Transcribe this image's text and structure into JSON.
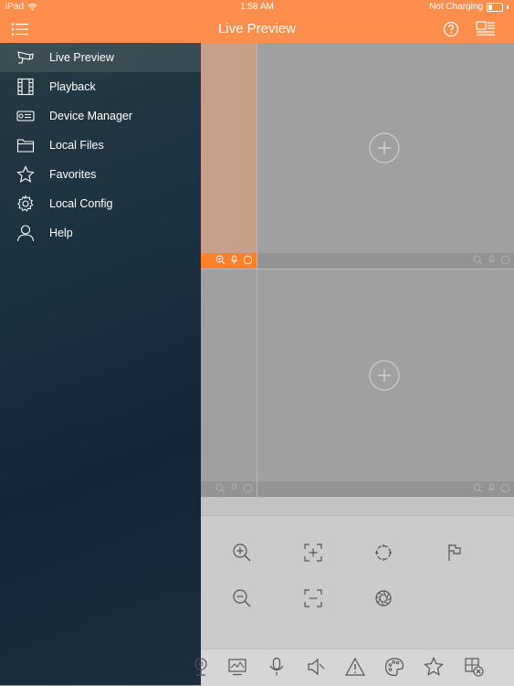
{
  "status_bar": {
    "device": "iPad",
    "time": "1:58 AM",
    "battery": "Not Charging"
  },
  "header": {
    "title": "Live Preview",
    "menu_icon": "list-menu-icon",
    "help_icon": "help-circle-icon",
    "layout_icon": "window-layout-icon"
  },
  "sidebar": {
    "items": [
      {
        "label": "Live Preview",
        "icon": "camera-icon",
        "active": true
      },
      {
        "label": "Playback",
        "icon": "film-icon",
        "active": false
      },
      {
        "label": "Device Manager",
        "icon": "dvr-device-icon",
        "active": false
      },
      {
        "label": "Local Files",
        "icon": "folder-icon",
        "active": false
      },
      {
        "label": "Favorites",
        "icon": "star-icon",
        "active": false
      },
      {
        "label": "Local Config",
        "icon": "gear-icon",
        "active": false
      },
      {
        "label": "Help",
        "icon": "user-icon",
        "active": false
      }
    ]
  },
  "video_panes": {
    "count": 4,
    "selected_index": 0,
    "bar_icons": [
      "zoom-icon",
      "microphone-icon",
      "record-icon"
    ],
    "add_icon": "add-channel-icon"
  },
  "ptz_controls": {
    "buttons": [
      "zoom-in-icon",
      "focus-plus-icon",
      "iris-open-icon",
      "preset-flag-icon",
      "zoom-out-icon",
      "focus-minus-icon",
      "iris-close-icon"
    ]
  },
  "toolbar": {
    "buttons": [
      "webcam-icon",
      "monitor-icon",
      "microphone-icon",
      "speaker-mute-icon",
      "alarm-warning-icon",
      "palette-icon",
      "favorite-star-icon",
      "close-all-windows-icon"
    ]
  },
  "colors": {
    "accent": "#ff8e4c",
    "selected_bar": "#ff7f2a",
    "drawer_dark": "#15263a"
  }
}
